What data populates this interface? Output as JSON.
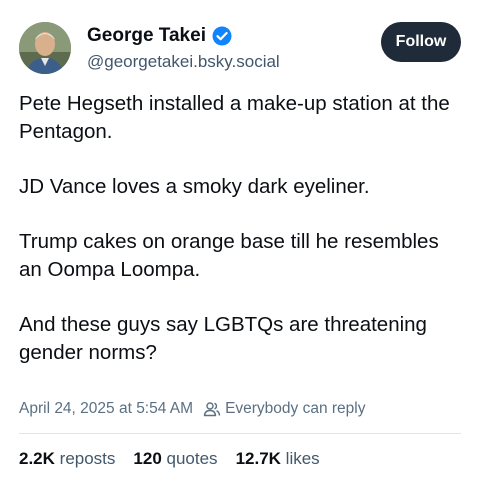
{
  "author": {
    "display_name": "George Takei",
    "handle": "@georgetakei.bsky.social",
    "verified_icon": "verified-check-icon",
    "verified_color": "#1083fe"
  },
  "follow_label": "Follow",
  "post": {
    "paragraphs": [
      "Pete Hegseth installed a make-up station at the Pentagon.",
      "JD Vance loves a smoky dark eyeliner.",
      "Trump cakes on orange base till he resembles an Oompa Loompa.",
      "And these guys say LGBTQs are threatening gender norms?"
    ],
    "timestamp": "April 24, 2025 at 5:54 AM",
    "reply_setting": "Everybody can reply"
  },
  "stats": {
    "reposts_count": "2.2K",
    "reposts_label": "reposts",
    "quotes_count": "120",
    "quotes_label": "quotes",
    "likes_count": "12.7K",
    "likes_label": "likes"
  },
  "colors": {
    "follow_bg": "#1f2b38",
    "secondary_text": "#42576c",
    "divider": "#dfe4ea"
  }
}
